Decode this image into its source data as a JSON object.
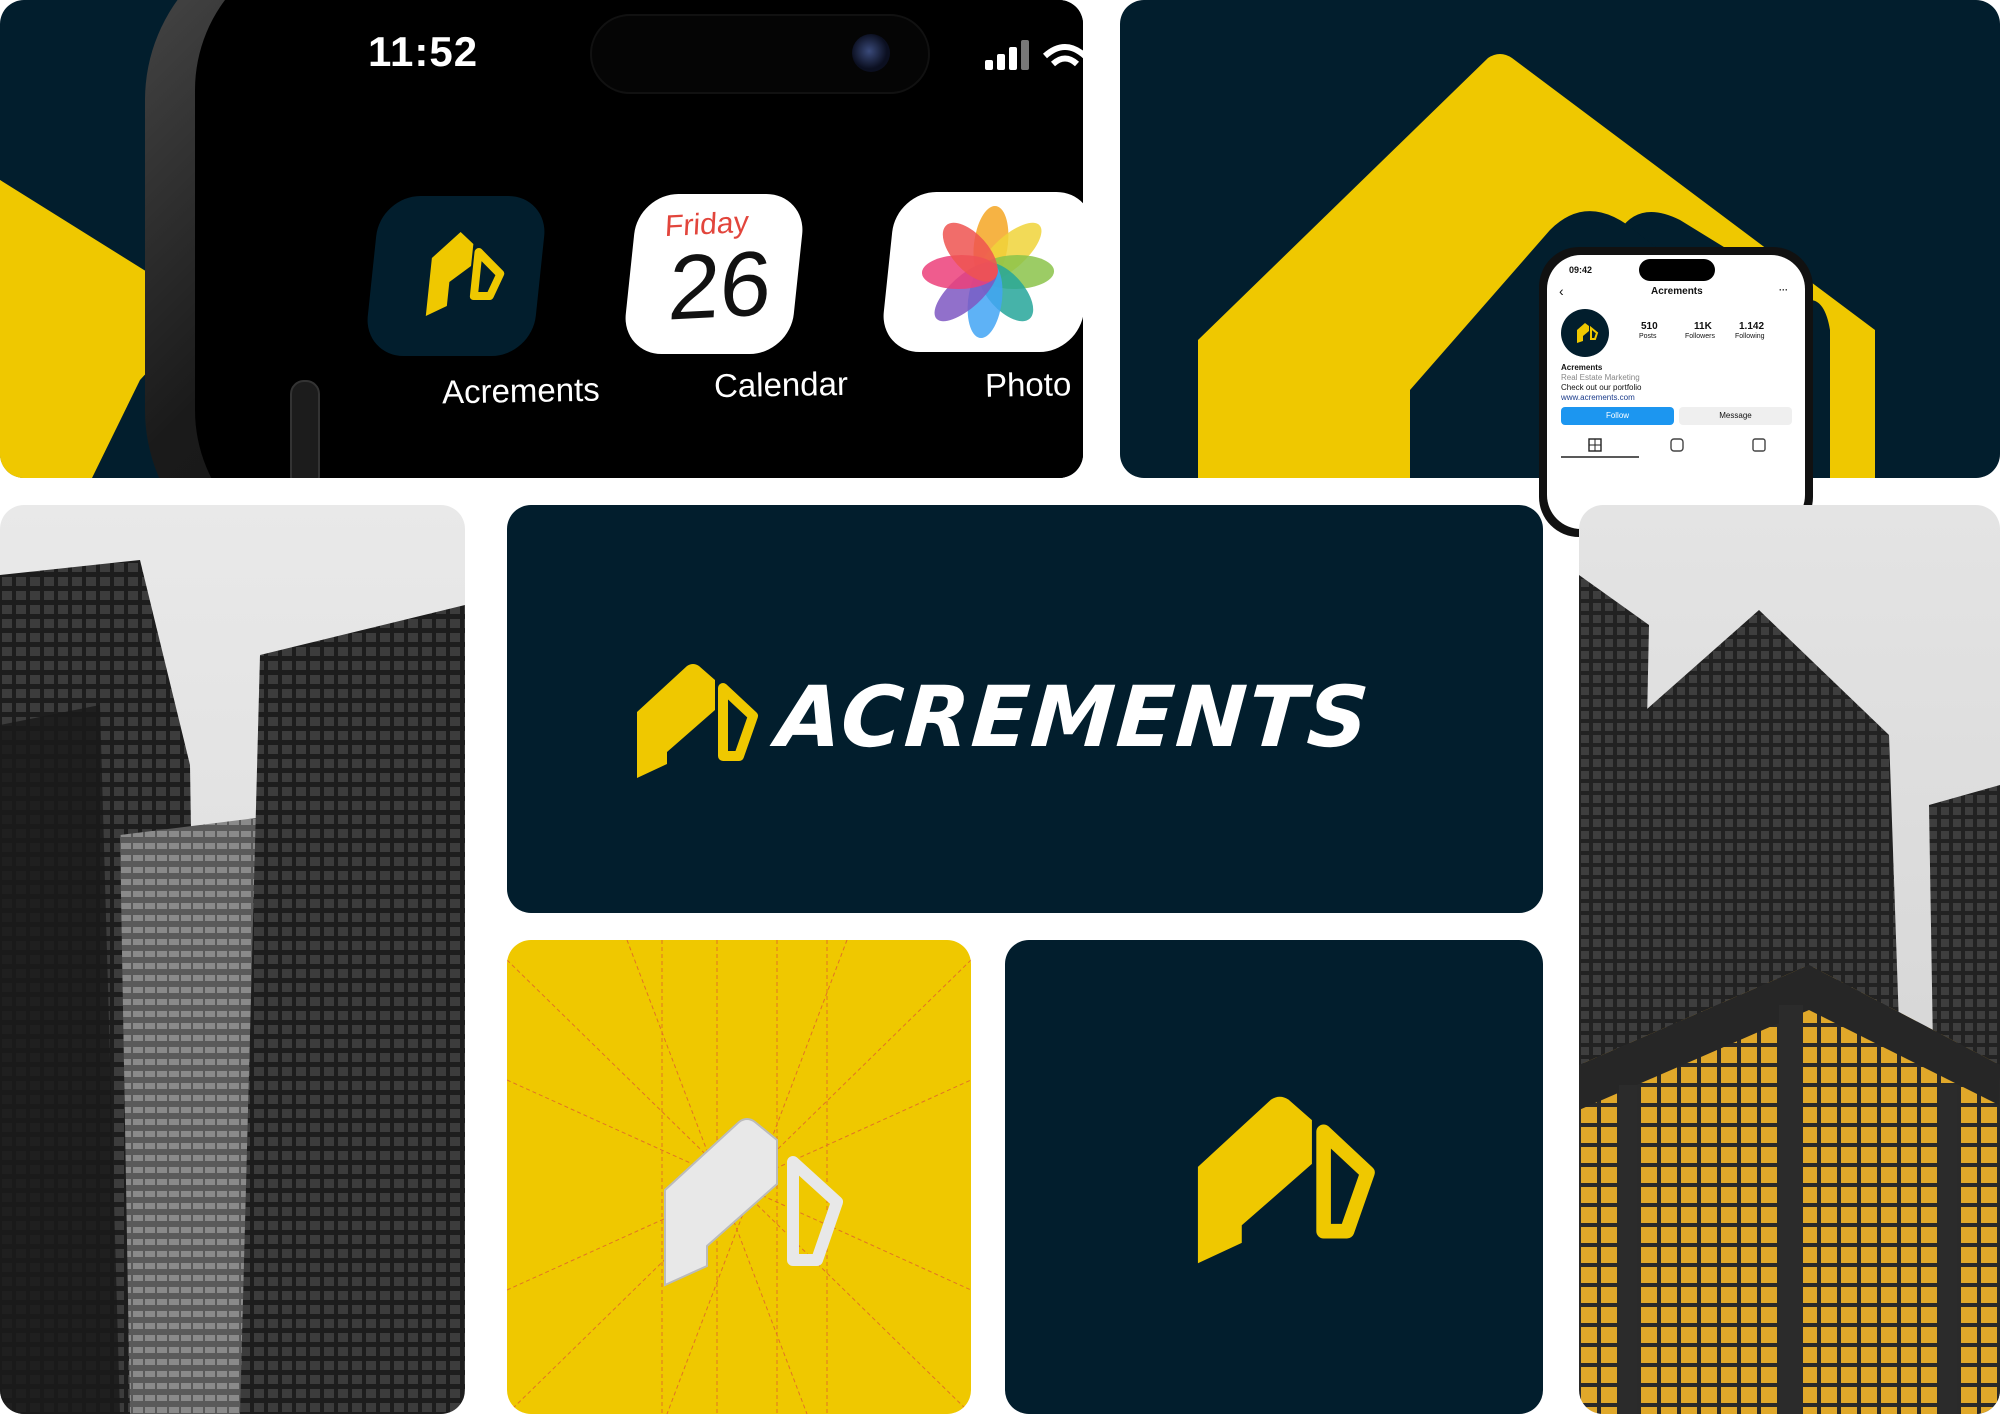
{
  "phone": {
    "time": "11:52",
    "apps": [
      {
        "label": "Acrements",
        "icon": "acrements-logo-icon"
      },
      {
        "label": "Calendar",
        "icon": "calendar-icon",
        "weekday": "Friday",
        "day": "26"
      },
      {
        "label": "Photo",
        "icon": "photos-icon"
      }
    ]
  },
  "instagram": {
    "time": "09:42",
    "username": "Acrements",
    "stats": [
      {
        "value": "510",
        "label": "Posts"
      },
      {
        "value": "11K",
        "label": "Followers"
      },
      {
        "value": "1.142",
        "label": "Following"
      }
    ],
    "profile_name": "Acrements",
    "category": "Real Estate Marketing",
    "bio": "Check out our portfolio",
    "website": "www.acrements.com",
    "follow_label": "Follow",
    "message_label": "Message"
  },
  "brand": {
    "wordmark": "ACREMENTS",
    "navy": "#021e2d",
    "yellow": "#efc800"
  }
}
